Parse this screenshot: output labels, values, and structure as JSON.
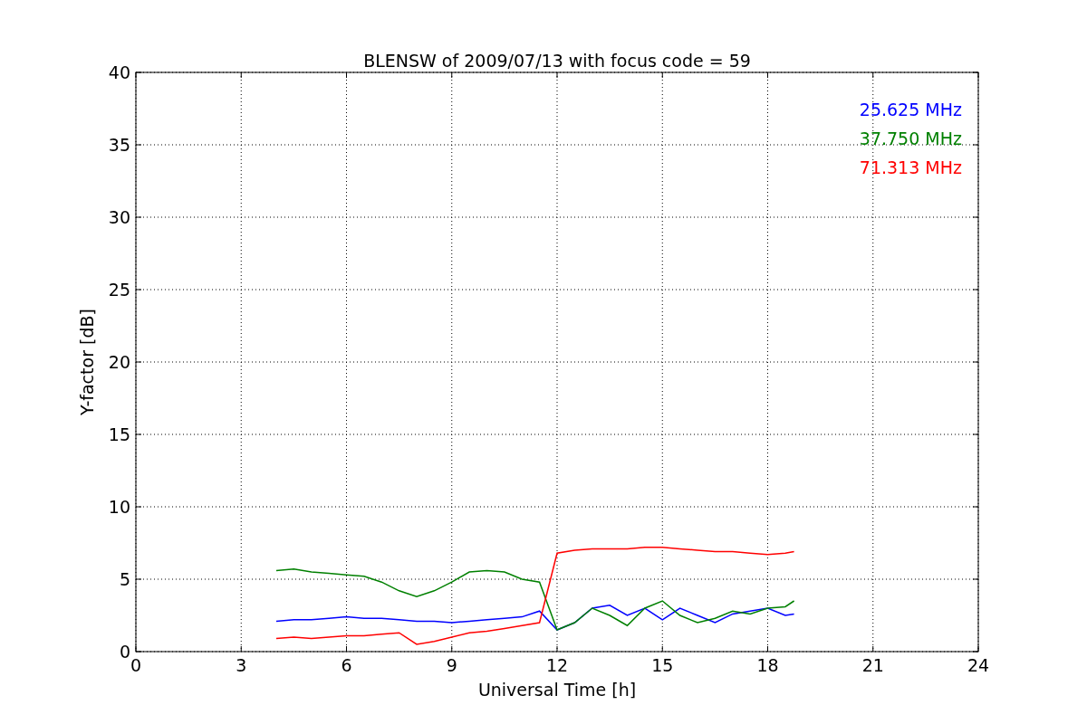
{
  "chart": {
    "chart_data": {
      "type": "line",
      "title": "BLENSW of 2009/07/13 with focus code = 59",
      "xlabel": "Universal Time [h]",
      "ylabel": "Y-factor [dB]",
      "x": [
        4,
        4.5,
        5,
        5.5,
        6,
        6.5,
        7,
        7.5,
        8,
        8.5,
        9,
        9.5,
        10,
        10.5,
        11,
        11.5,
        12,
        12.5,
        13,
        13.5,
        14,
        14.5,
        15,
        15.5,
        16,
        16.5,
        17,
        17.5,
        18,
        18.5,
        18.75
      ],
      "series": [
        {
          "name": "25.625 MHz",
          "color": "#0000ff",
          "values": [
            2.1,
            2.2,
            2.2,
            2.3,
            2.4,
            2.3,
            2.3,
            2.2,
            2.1,
            2.1,
            2.0,
            2.1,
            2.2,
            2.3,
            2.4,
            2.8,
            1.5,
            2.0,
            3.0,
            3.2,
            2.5,
            3.0,
            2.2,
            3.0,
            2.5,
            2.0,
            2.6,
            2.8,
            3.0,
            2.5,
            2.6
          ]
        },
        {
          "name": "37.750 MHz",
          "color": "#008000",
          "values": [
            5.6,
            5.7,
            5.5,
            5.4,
            5.3,
            5.2,
            4.8,
            4.2,
            3.8,
            4.2,
            4.8,
            5.5,
            5.6,
            5.5,
            5.0,
            4.8,
            1.5,
            2.0,
            3.0,
            2.5,
            1.8,
            3.0,
            3.5,
            2.5,
            2.0,
            2.3,
            2.8,
            2.6,
            3.0,
            3.1,
            3.5
          ]
        },
        {
          "name": "71.313 MHz",
          "color": "#ff0000",
          "values": [
            0.9,
            1.0,
            0.9,
            1.0,
            1.1,
            1.1,
            1.2,
            1.3,
            0.5,
            0.7,
            1.0,
            1.3,
            1.4,
            1.6,
            1.8,
            2.0,
            6.8,
            7.0,
            7.1,
            7.1,
            7.1,
            7.2,
            7.2,
            7.1,
            7.0,
            6.9,
            6.9,
            6.8,
            6.7,
            6.8,
            6.9
          ]
        }
      ],
      "xlim": [
        0,
        24
      ],
      "ylim": [
        0,
        40
      ],
      "xticks": [
        0,
        3,
        6,
        9,
        12,
        15,
        18,
        21,
        24
      ],
      "yticks": [
        0,
        5,
        10,
        15,
        20,
        25,
        30,
        35,
        40
      ],
      "grid": true
    }
  }
}
